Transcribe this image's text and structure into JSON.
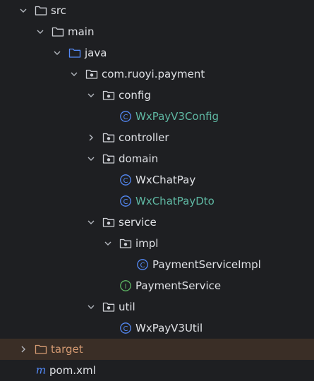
{
  "tree": {
    "items": [
      {
        "label": "src",
        "icon": "folder-icon",
        "expanded": true
      },
      {
        "label": "main",
        "icon": "folder-icon",
        "expanded": true
      },
      {
        "label": "java",
        "icon": "source-root-folder-icon",
        "expanded": true
      },
      {
        "label": "com.ruoyi.payment",
        "icon": "package-icon",
        "expanded": true
      },
      {
        "label": "config",
        "icon": "package-icon",
        "expanded": true
      },
      {
        "label": "WxPayV3Config",
        "icon": "class-icon"
      },
      {
        "label": "controller",
        "icon": "package-icon",
        "expanded": false
      },
      {
        "label": "domain",
        "icon": "package-icon",
        "expanded": true
      },
      {
        "label": "WxChatPay",
        "icon": "class-icon"
      },
      {
        "label": "WxChatPayDto",
        "icon": "class-icon"
      },
      {
        "label": "service",
        "icon": "package-icon",
        "expanded": true
      },
      {
        "label": "impl",
        "icon": "package-icon",
        "expanded": true
      },
      {
        "label": "PaymentServiceImpl",
        "icon": "class-icon"
      },
      {
        "label": "PaymentService",
        "icon": "interface-icon"
      },
      {
        "label": "util",
        "icon": "package-icon",
        "expanded": true
      },
      {
        "label": "WxPayV3Util",
        "icon": "class-icon"
      },
      {
        "label": "target",
        "icon": "excluded-folder-icon",
        "expanded": false
      },
      {
        "label": "pom.xml",
        "icon": "maven-icon"
      }
    ]
  },
  "colors": {
    "background": "#1e1f22",
    "text": "#dfe1e5",
    "modified_green": "#5fb8a3",
    "excluded_orange": "#d49a72",
    "excluded_row_bg": "#3a2e26",
    "source_root_blue": "#548af7",
    "class_icon_blue": "#548af7",
    "interface_icon_green": "#5fb865"
  },
  "glyphs": {
    "class": "C",
    "interface": "I",
    "maven": "m"
  }
}
